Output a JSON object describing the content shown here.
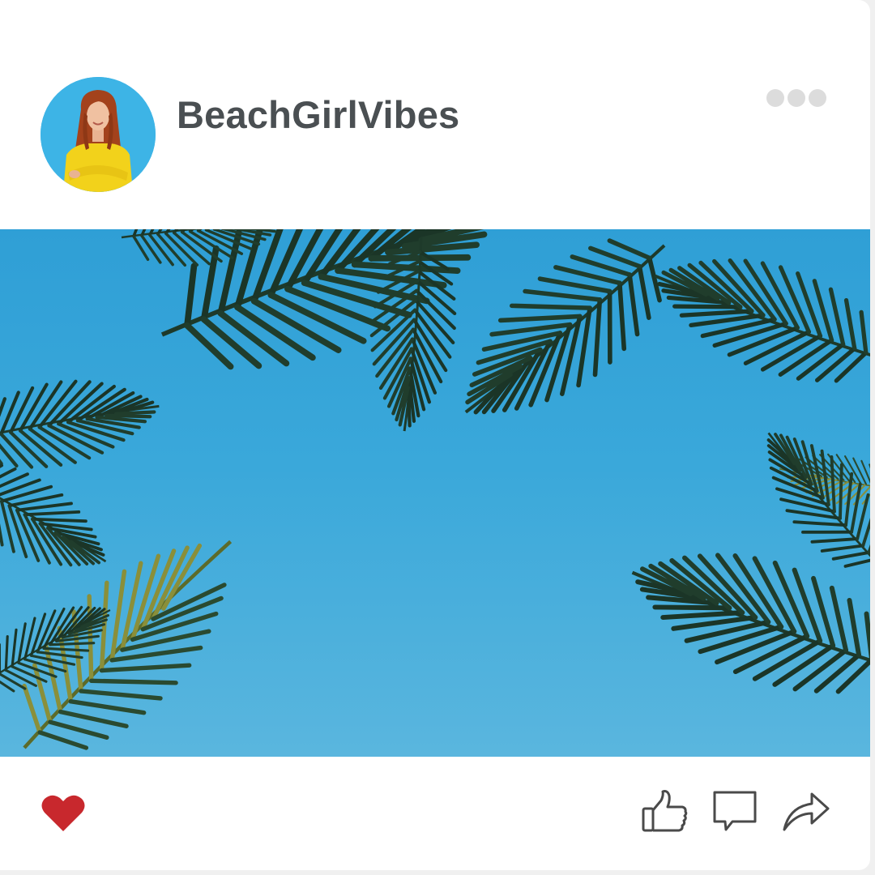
{
  "post": {
    "username": "BeachGirlVibes"
  },
  "icons": {
    "avatar": "profile-photo",
    "more": "more-options-icon",
    "like": "heart-icon",
    "thumb": "thumbs-up-icon",
    "comment": "comment-bubble-icon",
    "share": "share-arrow-icon"
  },
  "colors": {
    "heart": "#c8282d",
    "username": "#4a4f52",
    "sky": "#3aa8da",
    "avatar_bg": "#3db4e6",
    "sweater": "#f2d21b"
  }
}
